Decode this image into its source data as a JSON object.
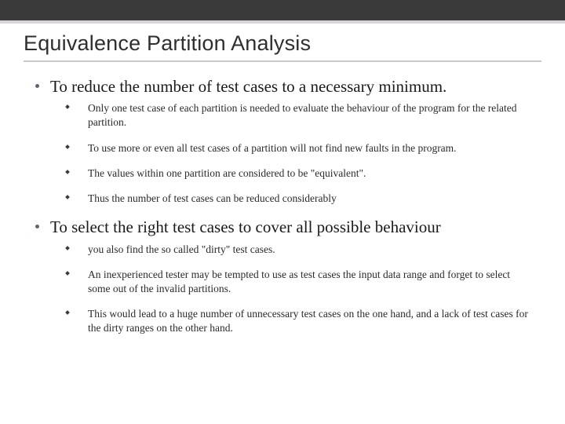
{
  "title": "Equivalence Partition Analysis",
  "sections": [
    {
      "heading": "To reduce the number of test cases to a necessary minimum.",
      "items": [
        "Only one test case of each partition is needed to evaluate the behaviour of the program for the related partition.",
        "To use more or even all test cases of a partition will not find new faults in the program.",
        "The values within one partition are considered to be \"equivalent\".",
        "Thus the number of test cases can be reduced considerably"
      ]
    },
    {
      "heading": "To select the right test cases to cover all possible behaviour",
      "items": [
        "you also find the so called \"dirty\" test cases.",
        "An inexperienced tester may be tempted to use as test cases the input data range and forget to select some out of the invalid partitions.",
        "This would lead to a huge number of unnecessary test cases on the one hand, and a lack of test cases for the dirty ranges on the other hand."
      ]
    }
  ]
}
